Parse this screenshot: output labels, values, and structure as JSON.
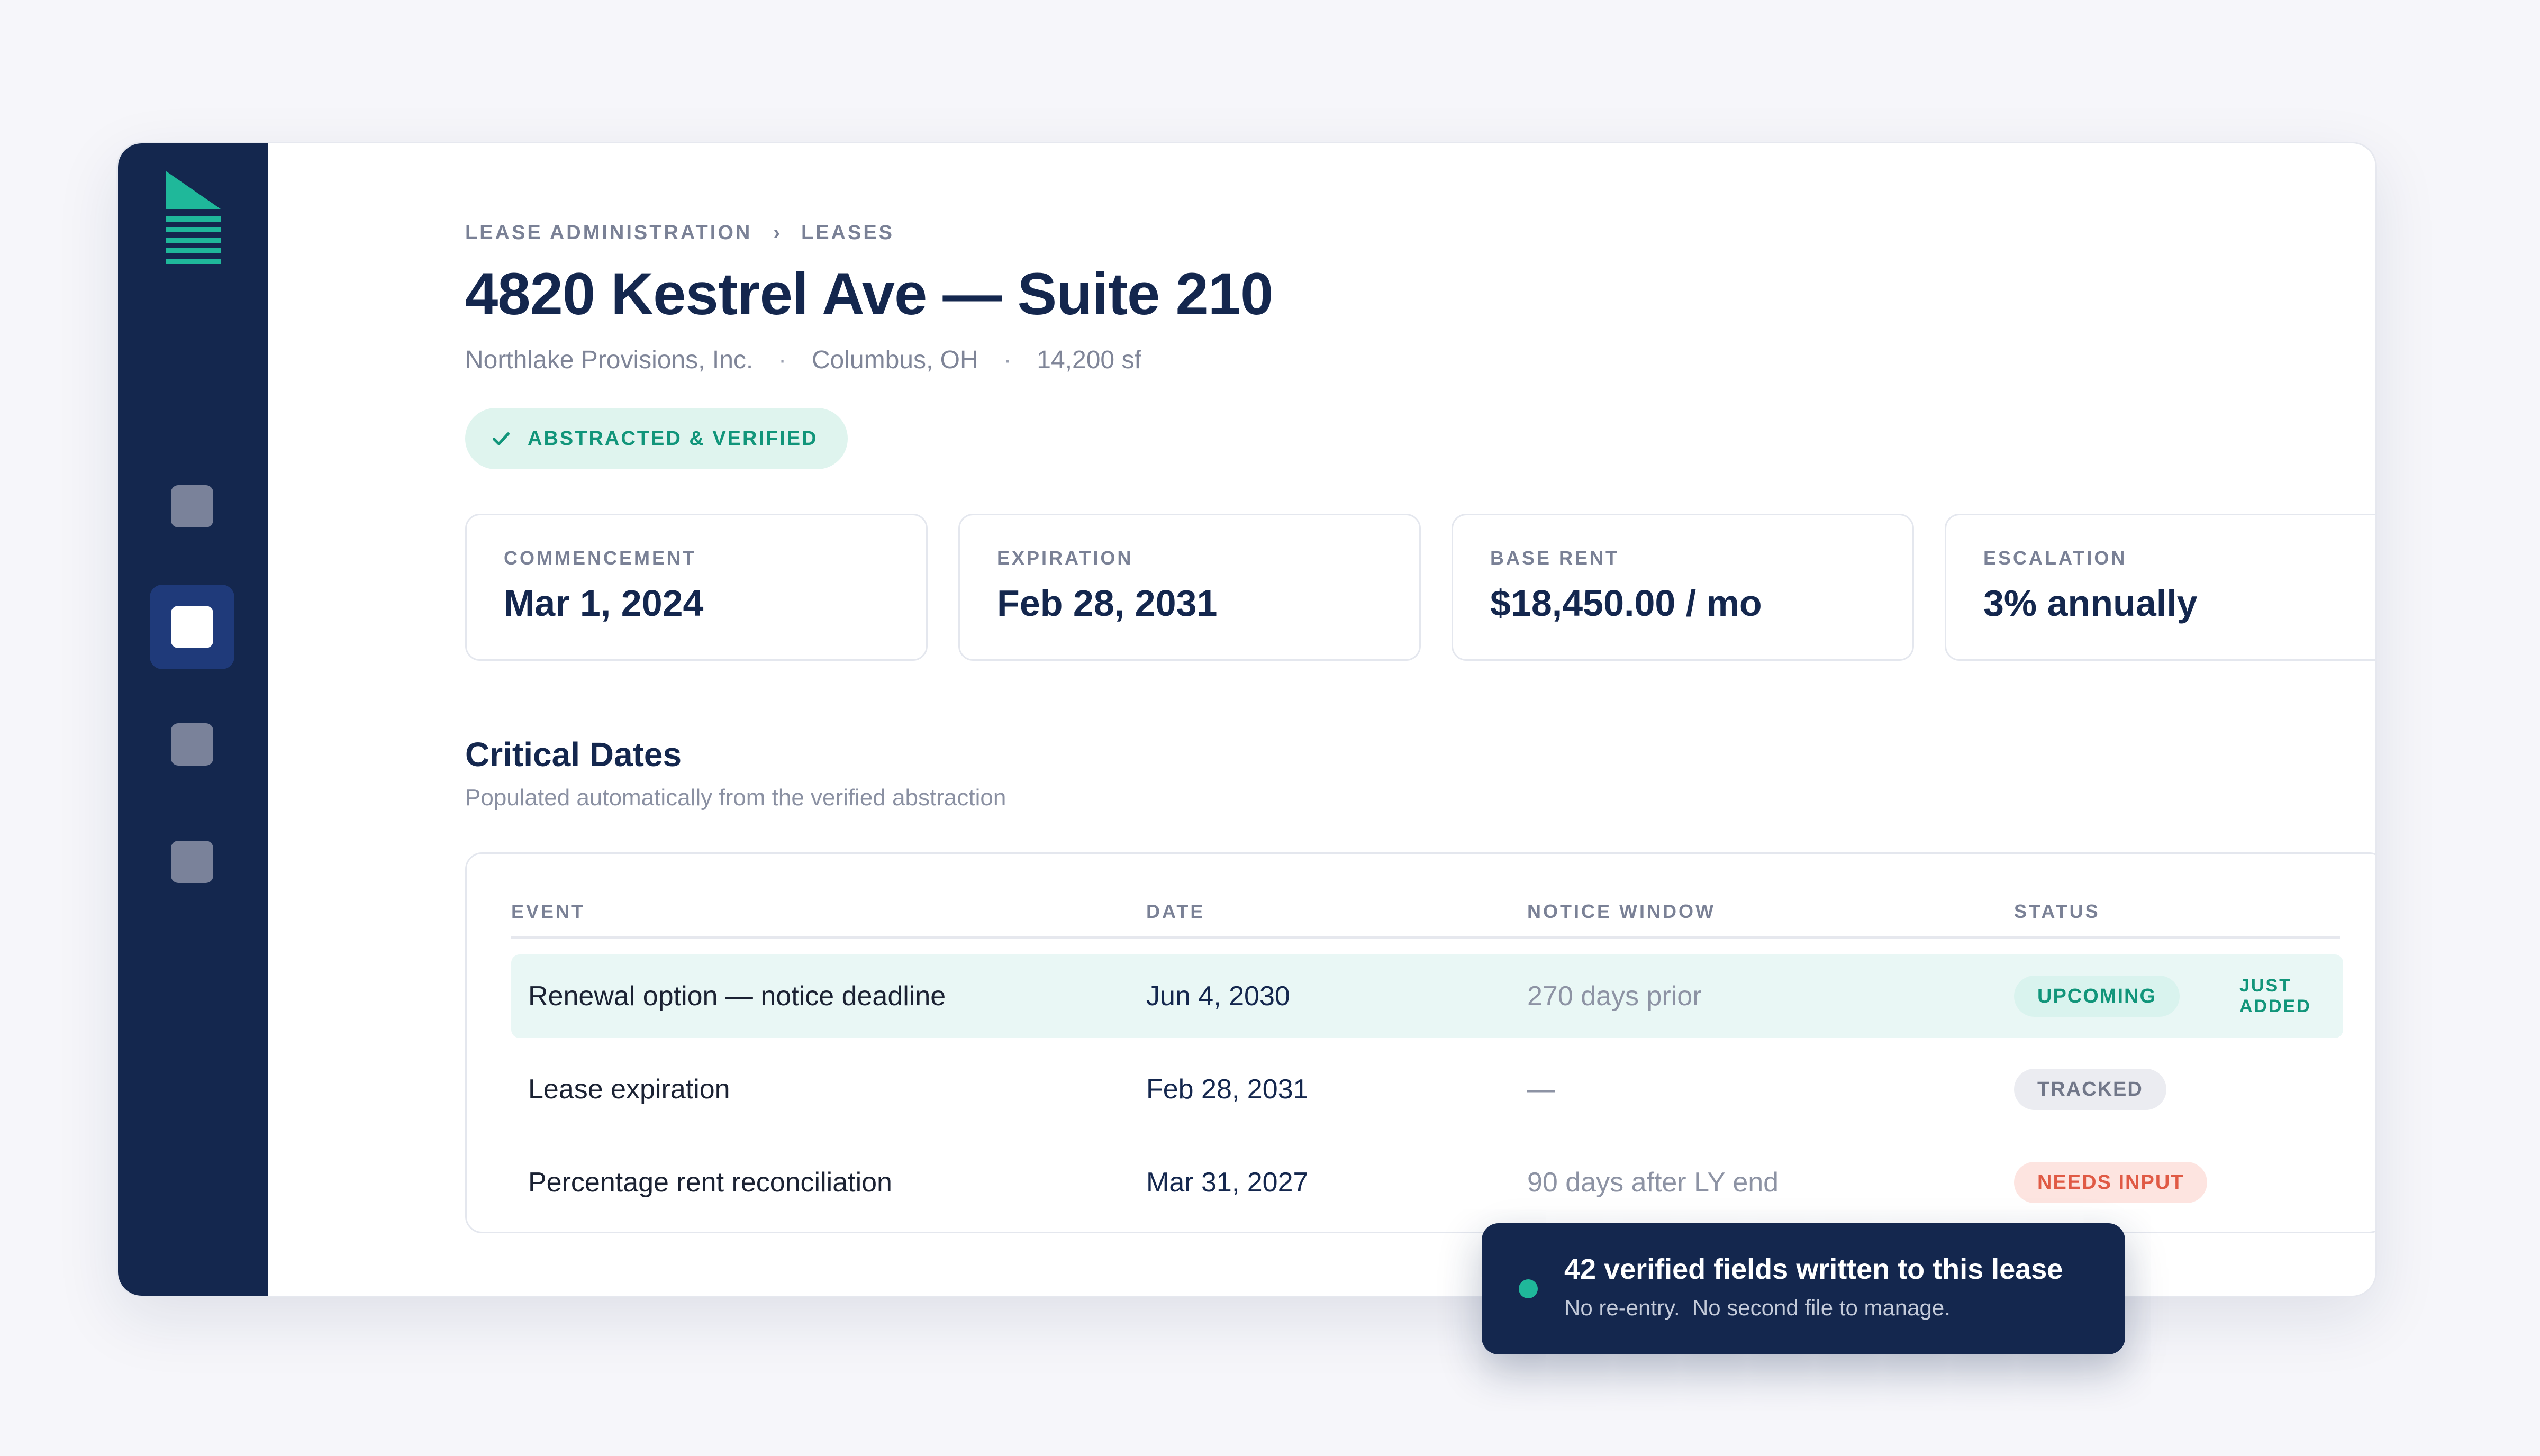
{
  "breadcrumb": {
    "items": [
      "LEASE ADMINISTRATION",
      "LEASES"
    ],
    "separator": "›"
  },
  "header": {
    "title": "4820 Kestrel Ave — Suite 210",
    "tenant": "Northlake Provisions, Inc.",
    "location": "Columbus, OH",
    "area": "14,200 sf",
    "separator": "·"
  },
  "verification": {
    "label": "ABSTRACTED & VERIFIED",
    "icon": "check-icon"
  },
  "summary_cards": [
    {
      "label": "COMMENCEMENT",
      "value": "Mar 1, 2024"
    },
    {
      "label": "EXPIRATION",
      "value": "Feb 28, 2031"
    },
    {
      "label": "BASE RENT",
      "value": "$18,450.00 / mo"
    },
    {
      "label": "ESCALATION",
      "value": "3% annually"
    }
  ],
  "critical_dates": {
    "title": "Critical Dates",
    "subtitle": "Populated automatically from the verified abstraction",
    "columns": [
      "EVENT",
      "DATE",
      "NOTICE WINDOW",
      "STATUS"
    ],
    "rows": [
      {
        "event": "Renewal option — notice deadline",
        "date": "Jun 4, 2030",
        "notice": "270 days prior",
        "status": "UPCOMING",
        "badge": "JUST ADDED"
      },
      {
        "event": "Lease expiration",
        "date": "Feb 28, 2031",
        "notice": "—",
        "status": "TRACKED"
      },
      {
        "event": "Percentage rent reconciliation",
        "date": "Mar 31, 2027",
        "notice": "90 days after LY end",
        "status": "NEEDS INPUT"
      }
    ]
  },
  "toast": {
    "title": "42 verified fields written to this lease",
    "message": "No re-entry.  No second file to manage."
  },
  "colors": {
    "navy": "#14274e",
    "accent_green": "#11957a",
    "highlight_row": "#e9f7f5",
    "alert_red": "#e05a45"
  }
}
